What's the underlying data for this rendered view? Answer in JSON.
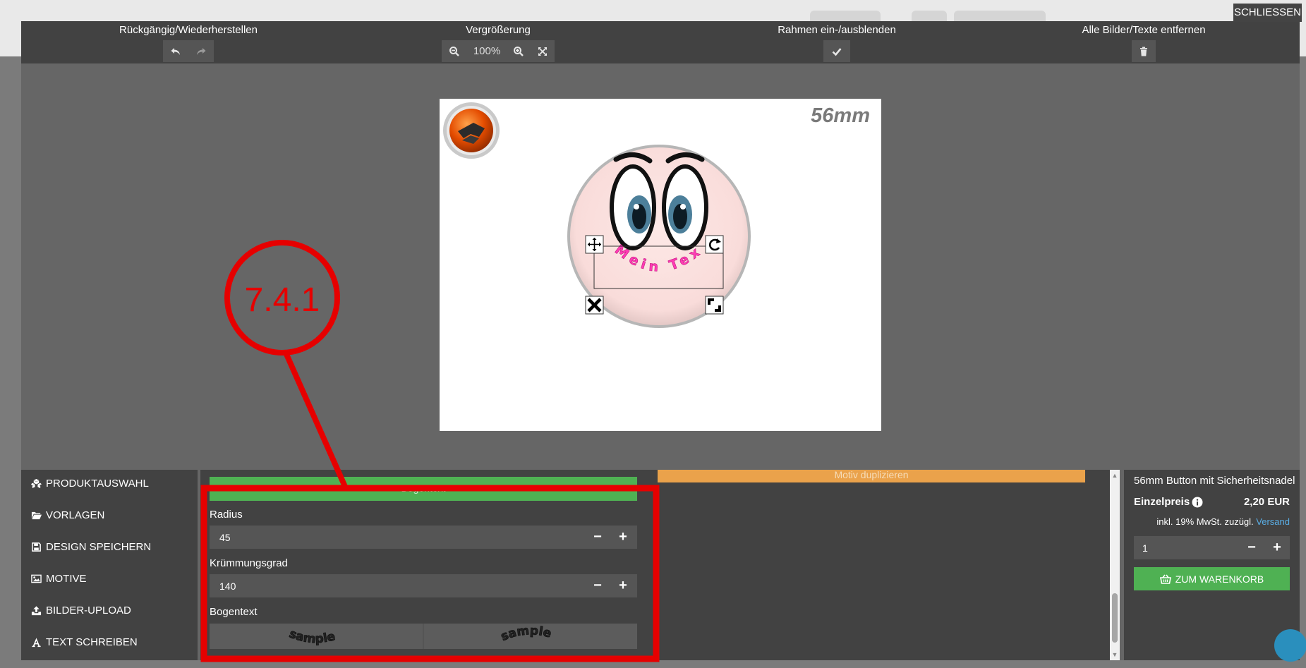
{
  "close_label": "SCHLIESSEN",
  "toolbar": {
    "undo_redo_label": "Rückgängig/Wiederherstellen",
    "zoom_label": "Vergrößerung",
    "zoom_value": "100%",
    "frame_label": "Rahmen ein-/ausblenden",
    "remove_all_label": "Alle Bilder/Texte entfernen"
  },
  "canvas": {
    "size_label": "56mm",
    "curved_text": "Mein Text"
  },
  "sidebar": {
    "items": [
      {
        "label": "PRODUKTAUSWAHL",
        "icon": "cubes-icon"
      },
      {
        "label": "VORLAGEN",
        "icon": "folder-icon"
      },
      {
        "label": "DESIGN SPEICHERN",
        "icon": "floppy-icon"
      },
      {
        "label": "MOTIVE",
        "icon": "image-icon"
      },
      {
        "label": "BILDER-UPLOAD",
        "icon": "upload-icon"
      },
      {
        "label": "TEXT SCHREIBEN",
        "icon": "font-icon"
      }
    ]
  },
  "editor": {
    "green_bar_label": "Bogentext",
    "orange_bar_label": "Motiv duplizieren",
    "radius_label": "Radius",
    "radius_value": "45",
    "curvature_label": "Krümmungsgrad",
    "curvature_value": "140",
    "arc_label": "Bogentext",
    "arc_sample": "sample"
  },
  "product": {
    "title": "56mm Button mit Sicherheitsnadel",
    "price_label": "Einzelpreis",
    "price_value": "2,20 EUR",
    "tax_note": "inkl. 19% MwSt. zuzügl.",
    "shipping_link": "Versand",
    "quantity": "1",
    "cart_label": "ZUM WARENKORB"
  },
  "annotation": {
    "label": "7.4.1",
    "color": "#e60000"
  },
  "colors": {
    "accent_green": "#4fb153",
    "accent_orange": "#eaa24b",
    "text_pink": "#ff3db5"
  }
}
